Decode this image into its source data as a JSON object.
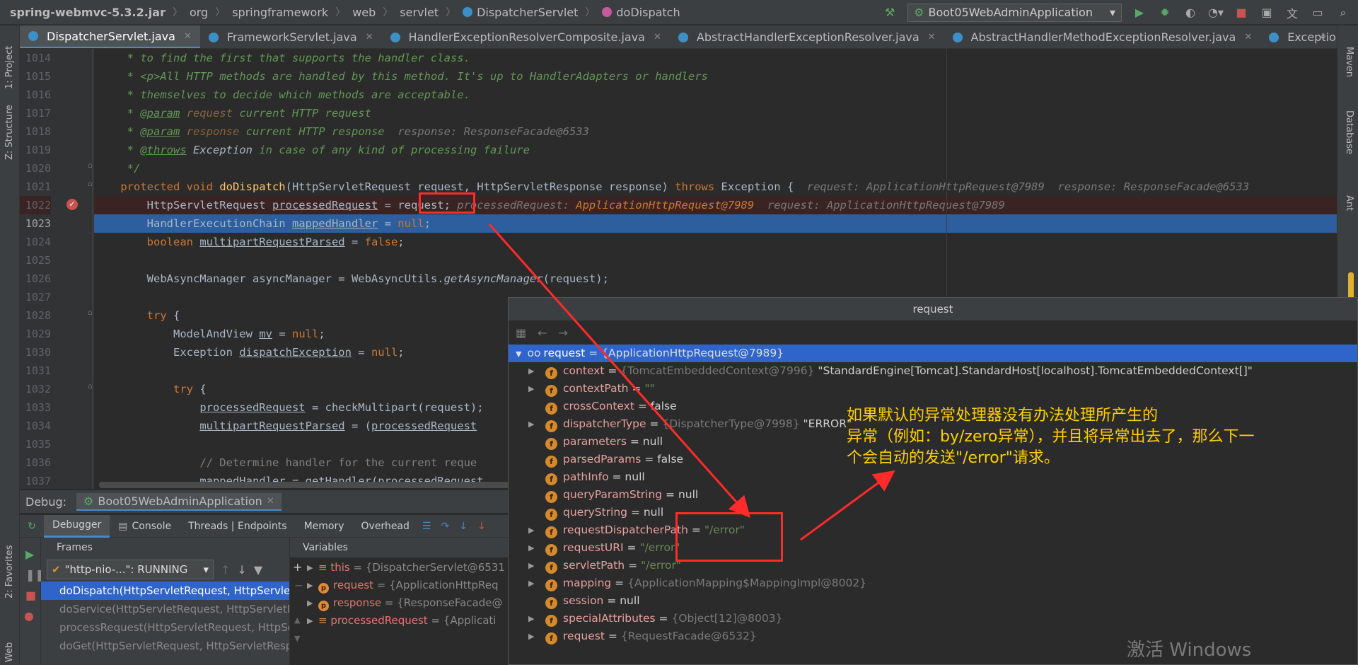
{
  "breadcrumb": [
    "spring-webmvc-5.3.2.jar",
    "org",
    "springframework",
    "web",
    "servlet",
    "DispatcherServlet",
    "doDispatch"
  ],
  "run_config": "Boot05WebAdminApplication",
  "tabs": [
    "DispatcherServlet.java",
    "FrameworkServlet.java",
    "HandlerExceptionResolverComposite.java",
    "AbstractHandlerExceptionResolver.java",
    "AbstractHandlerMethodExceptionResolver.java",
    "ExceptionHandlerExceptionRe"
  ],
  "left_strip": {
    "project": "1: Project",
    "structure": "Z: Structure",
    "favorites": "2: Favorites",
    "web": "Web"
  },
  "right_strip": {
    "maven": "Maven",
    "database": "Database",
    "ant": "Ant"
  },
  "code": {
    "line_numbers": [
      "1014",
      "1015",
      "1016",
      "1017",
      "1018",
      "1019",
      "1020",
      "1021",
      "1022",
      "1023",
      "1024",
      "1025",
      "1026",
      "1027",
      "1028",
      "1029",
      "1030",
      "1031",
      "1032",
      "1033",
      "1034",
      "1035",
      "1036",
      "1037"
    ],
    "l1014": "* to find the first that supports the handler class.",
    "l1015a": "* <p>",
    "l1015b": "All HTTP methods are handled by this method. It's up to HandlerAdapters or handlers",
    "l1016": "* themselves to decide which methods are acceptable.",
    "l1017a": "* ",
    "l1017tag": "@param",
    "l1017p": " request",
    "l1017b": " current HTTP request",
    "l1018a": "* ",
    "l1018tag": "@param",
    "l1018p": " response",
    "l1018b": " current HTTP response  ",
    "l1018h": "response: ResponseFacade@6533",
    "l1019a": "* ",
    "l1019tag": "@throws",
    "l1019b": " Exception",
    "l1019c": " in case of any kind of processing failure",
    "l1020": "*/",
    "l1021kw": "protected void ",
    "l1021fn": "doDispatch",
    "l1021a": "(HttpServletRequest request, HttpServletResponse response) ",
    "l1021kw2": "throws",
    "l1021b": " Exception {  ",
    "l1021h": "request: ApplicationHttpRequest@7989  response: ResponseFacade@6533",
    "l1022a": "HttpServletRequest ",
    "l1022v": "processedRequest",
    "l1022b": " = ",
    "l1022c": "request;",
    "l1022h1": " processedRequest: ",
    "l1022h2": "ApplicationHttpRequest@7989",
    "l1022h3": "  request: ApplicationHttpRequest@7989",
    "l1023a": "HandlerExecutionChain ",
    "l1023v": "mappedHandler",
    "l1023b": " = ",
    "l1023kw": "null",
    "l1023c": ";",
    "l1024kw": "boolean ",
    "l1024v": "multipartRequestParsed",
    "l1024b": " = ",
    "l1024kw2": "false",
    "l1024c": ";",
    "l1026a": "WebAsyncManager asyncManager = WebAsyncUtils.",
    "l1026it": "getAsyncManager",
    "l1026b": "(request);",
    "l1028kw": "try",
    "l1028a": " {",
    "l1029a": "ModelAndView ",
    "l1029v": "mv",
    "l1029b": " = ",
    "l1029kw": "null",
    "l1029c": ";",
    "l1030a": "Exception ",
    "l1030v": "dispatchException",
    "l1030b": " = ",
    "l1030kw": "null",
    "l1030c": ";",
    "l1032kw": "try",
    "l1032a": " {",
    "l1033v": "processedRequest",
    "l1033a": " = checkMultipart(request);",
    "l1034v": "multipartRequestParsed",
    "l1034a": " = (",
    "l1034v2": "processedRequest",
    "l1036": "// Determine handler for the current reque",
    "l1037v": "mappedHandler",
    "l1037a": " = getHandler(processedRequest"
  },
  "debug": {
    "label": "Debug:",
    "session": "Boot05WebAdminApplication",
    "tabs": [
      "Debugger",
      "Console",
      "Threads | Endpoints",
      "Memory",
      "Overhead"
    ],
    "frames_header": "Frames",
    "variables_header": "Variables",
    "thread": "\"http-nio-...\": RUNNING",
    "frames": [
      "doDispatch(HttpServletRequest, HttpServlet",
      "doService(HttpServletRequest, HttpServletR",
      "processRequest(HttpServletRequest, HttpSe",
      "doGet(HttpServletRequest, HttpServletResp"
    ],
    "variables": [
      {
        "name": "this",
        "value": " = {DispatcherServlet@6531"
      },
      {
        "name": "request",
        "value": " = {ApplicationHttpReq"
      },
      {
        "name": "response",
        "value": " = {ResponseFacade@"
      },
      {
        "name": "processedRequest",
        "value": " = {Applicati"
      }
    ]
  },
  "popup": {
    "title": "request",
    "root": {
      "name": "request",
      "value": " = {ApplicationHttpRequest@7989}"
    },
    "rows": [
      {
        "name": "context",
        "eq": " = ",
        "ref": "{TomcatEmbeddedContext@7996}",
        "str": " \"StandardEngine[Tomcat].StandardHost[localhost].TomcatEmbeddedContext[]\"",
        "expand": true
      },
      {
        "name": "contextPath",
        "eq": " = ",
        "ref": "",
        "str": "\"\"",
        "expand": true,
        "green": true
      },
      {
        "name": "crossContext",
        "eq": " = ",
        "ref": "",
        "str": "false",
        "expand": false
      },
      {
        "name": "dispatcherType",
        "eq": " = ",
        "ref": "{DispatcherType@7998}",
        "str": " \"ERROR\"",
        "expand": true
      },
      {
        "name": "parameters",
        "eq": " = ",
        "ref": "",
        "str": "null",
        "expand": false
      },
      {
        "name": "parsedParams",
        "eq": " = ",
        "ref": "",
        "str": "false",
        "expand": false
      },
      {
        "name": "pathInfo",
        "eq": " = ",
        "ref": "",
        "str": "null",
        "expand": false
      },
      {
        "name": "queryParamString",
        "eq": " = ",
        "ref": "",
        "str": "null",
        "expand": false
      },
      {
        "name": "queryString",
        "eq": " = ",
        "ref": "",
        "str": "null",
        "expand": false
      },
      {
        "name": "requestDispatcherPath",
        "eq": " = ",
        "ref": "",
        "str": "\"/error\"",
        "expand": true,
        "green": true
      },
      {
        "name": "requestURI",
        "eq": " = ",
        "ref": "",
        "str": "\"/error\"",
        "expand": true,
        "green": true
      },
      {
        "name": "servletPath",
        "eq": " = ",
        "ref": "",
        "str": "\"/error\"",
        "expand": true,
        "green": true
      },
      {
        "name": "mapping",
        "eq": " = ",
        "ref": "{ApplicationMapping$MappingImpl@8002}",
        "str": "",
        "expand": true
      },
      {
        "name": "session",
        "eq": " = ",
        "ref": "",
        "str": "null",
        "expand": false
      },
      {
        "name": "specialAttributes",
        "eq": " = ",
        "ref": "{Object[12]@8003}",
        "str": "",
        "expand": true
      },
      {
        "name": "request",
        "eq": " = ",
        "ref": "{RequestFacade@6532}",
        "str": "",
        "expand": true
      }
    ]
  },
  "annotation": {
    "line1": "如果默认的异常处理器没有办法处理所产生的",
    "line2": "异常（例如：by/zero异常），并且将异常出去了，那么下一",
    "line3": "个会自动的发送\"/error\"请求。"
  },
  "watermark": "激活 Windows",
  "colors": {
    "accent": "#2f65ca",
    "annotation": "#ffd000",
    "highlight": "#ff2a2a"
  }
}
